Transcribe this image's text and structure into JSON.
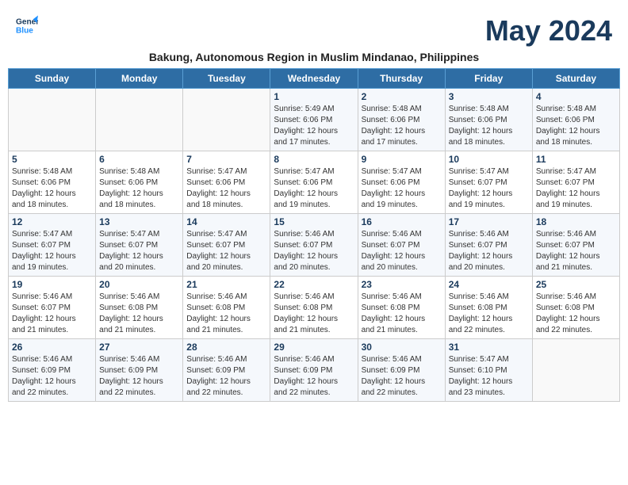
{
  "header": {
    "logo_line1": "General",
    "logo_line2": "Blue",
    "month_year": "May 2024",
    "subtitle": "Bakung, Autonomous Region in Muslim Mindanao, Philippines"
  },
  "days_of_week": [
    "Sunday",
    "Monday",
    "Tuesday",
    "Wednesday",
    "Thursday",
    "Friday",
    "Saturday"
  ],
  "weeks": [
    [
      {
        "day": "",
        "info": ""
      },
      {
        "day": "",
        "info": ""
      },
      {
        "day": "",
        "info": ""
      },
      {
        "day": "1",
        "info": "Sunrise: 5:49 AM\nSunset: 6:06 PM\nDaylight: 12 hours\nand 17 minutes."
      },
      {
        "day": "2",
        "info": "Sunrise: 5:48 AM\nSunset: 6:06 PM\nDaylight: 12 hours\nand 17 minutes."
      },
      {
        "day": "3",
        "info": "Sunrise: 5:48 AM\nSunset: 6:06 PM\nDaylight: 12 hours\nand 18 minutes."
      },
      {
        "day": "4",
        "info": "Sunrise: 5:48 AM\nSunset: 6:06 PM\nDaylight: 12 hours\nand 18 minutes."
      }
    ],
    [
      {
        "day": "5",
        "info": "Sunrise: 5:48 AM\nSunset: 6:06 PM\nDaylight: 12 hours\nand 18 minutes."
      },
      {
        "day": "6",
        "info": "Sunrise: 5:48 AM\nSunset: 6:06 PM\nDaylight: 12 hours\nand 18 minutes."
      },
      {
        "day": "7",
        "info": "Sunrise: 5:47 AM\nSunset: 6:06 PM\nDaylight: 12 hours\nand 18 minutes."
      },
      {
        "day": "8",
        "info": "Sunrise: 5:47 AM\nSunset: 6:06 PM\nDaylight: 12 hours\nand 19 minutes."
      },
      {
        "day": "9",
        "info": "Sunrise: 5:47 AM\nSunset: 6:06 PM\nDaylight: 12 hours\nand 19 minutes."
      },
      {
        "day": "10",
        "info": "Sunrise: 5:47 AM\nSunset: 6:07 PM\nDaylight: 12 hours\nand 19 minutes."
      },
      {
        "day": "11",
        "info": "Sunrise: 5:47 AM\nSunset: 6:07 PM\nDaylight: 12 hours\nand 19 minutes."
      }
    ],
    [
      {
        "day": "12",
        "info": "Sunrise: 5:47 AM\nSunset: 6:07 PM\nDaylight: 12 hours\nand 19 minutes."
      },
      {
        "day": "13",
        "info": "Sunrise: 5:47 AM\nSunset: 6:07 PM\nDaylight: 12 hours\nand 20 minutes."
      },
      {
        "day": "14",
        "info": "Sunrise: 5:47 AM\nSunset: 6:07 PM\nDaylight: 12 hours\nand 20 minutes."
      },
      {
        "day": "15",
        "info": "Sunrise: 5:46 AM\nSunset: 6:07 PM\nDaylight: 12 hours\nand 20 minutes."
      },
      {
        "day": "16",
        "info": "Sunrise: 5:46 AM\nSunset: 6:07 PM\nDaylight: 12 hours\nand 20 minutes."
      },
      {
        "day": "17",
        "info": "Sunrise: 5:46 AM\nSunset: 6:07 PM\nDaylight: 12 hours\nand 20 minutes."
      },
      {
        "day": "18",
        "info": "Sunrise: 5:46 AM\nSunset: 6:07 PM\nDaylight: 12 hours\nand 21 minutes."
      }
    ],
    [
      {
        "day": "19",
        "info": "Sunrise: 5:46 AM\nSunset: 6:07 PM\nDaylight: 12 hours\nand 21 minutes."
      },
      {
        "day": "20",
        "info": "Sunrise: 5:46 AM\nSunset: 6:08 PM\nDaylight: 12 hours\nand 21 minutes."
      },
      {
        "day": "21",
        "info": "Sunrise: 5:46 AM\nSunset: 6:08 PM\nDaylight: 12 hours\nand 21 minutes."
      },
      {
        "day": "22",
        "info": "Sunrise: 5:46 AM\nSunset: 6:08 PM\nDaylight: 12 hours\nand 21 minutes."
      },
      {
        "day": "23",
        "info": "Sunrise: 5:46 AM\nSunset: 6:08 PM\nDaylight: 12 hours\nand 21 minutes."
      },
      {
        "day": "24",
        "info": "Sunrise: 5:46 AM\nSunset: 6:08 PM\nDaylight: 12 hours\nand 22 minutes."
      },
      {
        "day": "25",
        "info": "Sunrise: 5:46 AM\nSunset: 6:08 PM\nDaylight: 12 hours\nand 22 minutes."
      }
    ],
    [
      {
        "day": "26",
        "info": "Sunrise: 5:46 AM\nSunset: 6:09 PM\nDaylight: 12 hours\nand 22 minutes."
      },
      {
        "day": "27",
        "info": "Sunrise: 5:46 AM\nSunset: 6:09 PM\nDaylight: 12 hours\nand 22 minutes."
      },
      {
        "day": "28",
        "info": "Sunrise: 5:46 AM\nSunset: 6:09 PM\nDaylight: 12 hours\nand 22 minutes."
      },
      {
        "day": "29",
        "info": "Sunrise: 5:46 AM\nSunset: 6:09 PM\nDaylight: 12 hours\nand 22 minutes."
      },
      {
        "day": "30",
        "info": "Sunrise: 5:46 AM\nSunset: 6:09 PM\nDaylight: 12 hours\nand 22 minutes."
      },
      {
        "day": "31",
        "info": "Sunrise: 5:47 AM\nSunset: 6:10 PM\nDaylight: 12 hours\nand 23 minutes."
      },
      {
        "day": "",
        "info": ""
      }
    ]
  ]
}
